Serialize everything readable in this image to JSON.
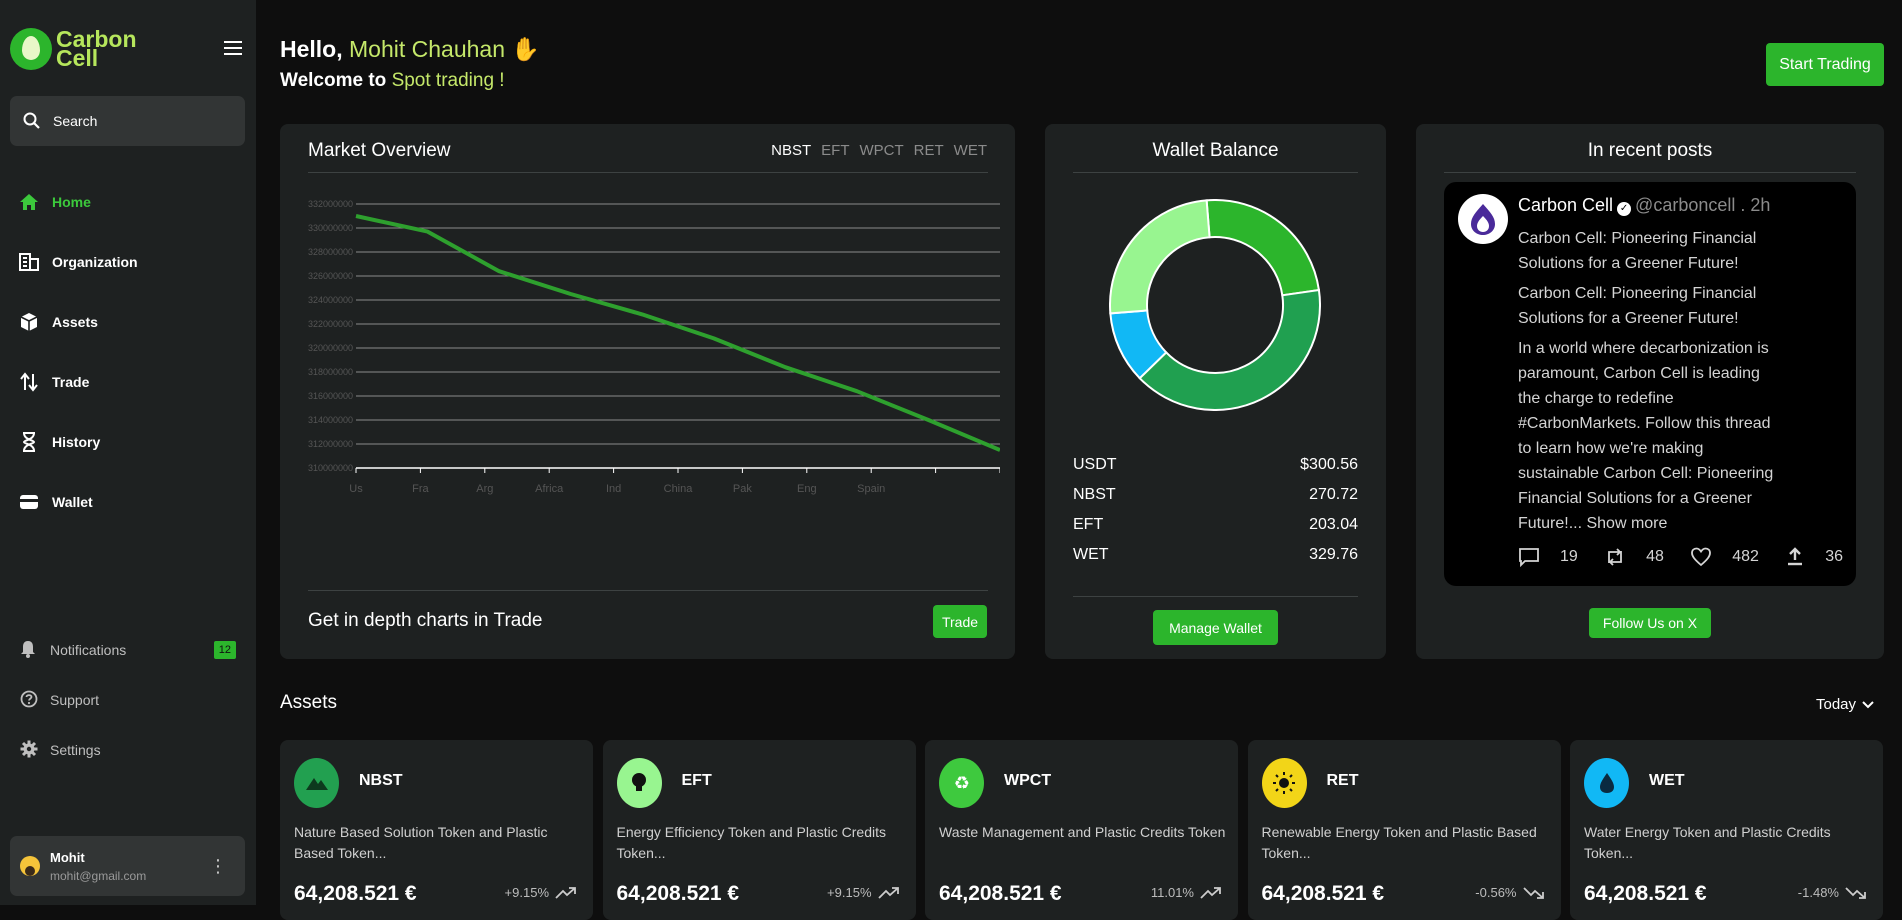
{
  "sidebar": {
    "logo_line1": "Carbon",
    "logo_line2": "Cell",
    "search_placeholder": "Search",
    "nav": [
      {
        "label": "Home",
        "icon": "home-icon"
      },
      {
        "label": "Organization",
        "icon": "organization-icon"
      },
      {
        "label": "Assets",
        "icon": "assets-icon"
      },
      {
        "label": "Trade",
        "icon": "trade-icon"
      },
      {
        "label": "History",
        "icon": "hourglass-icon"
      },
      {
        "label": "Wallet",
        "icon": "wallet-icon"
      }
    ],
    "bottom_nav": [
      {
        "label": "Notifications",
        "badge": "12"
      },
      {
        "label": "Support"
      },
      {
        "label": "Settings"
      }
    ],
    "user": {
      "name": "Mohit",
      "email": "mohit@gmail.com"
    }
  },
  "header": {
    "hello": "Hello,",
    "name": "Mohit Chauhan",
    "welcome": "Welcome to",
    "welcome_hl": "Spot trading !",
    "start_trading": "Start Trading"
  },
  "market": {
    "title": "Market Overview",
    "tabs": [
      "NBST",
      "EFT",
      "WPCT",
      "RET",
      "WET"
    ],
    "active_tab": "NBST",
    "footer_text": "Get in depth charts in Trade",
    "trade_button": "Trade"
  },
  "chart_data": {
    "type": "line",
    "categories": [
      "Us",
      "Fra",
      "Arg",
      "Africa",
      "Ind",
      "China",
      "Pak",
      "Eng",
      "Spain",
      ""
    ],
    "series": [
      {
        "values": [
          331000000,
          329700000,
          326400000,
          324500000,
          322800000,
          320800000,
          318400000,
          316400000,
          314000000,
          311500000
        ]
      }
    ],
    "yticks": [
      "332000000",
      "330000000",
      "328000000",
      "326000000",
      "324000000",
      "322000000",
      "320000000",
      "318000000",
      "316000000",
      "314000000",
      "312000000",
      "310000000"
    ],
    "ylim": [
      310000000,
      332000000
    ],
    "color": "#2ea02e",
    "grid": true
  },
  "wallet": {
    "title": "Wallet Balance",
    "rows": [
      {
        "label": "USDT",
        "value": "$300.56"
      },
      {
        "label": "NBST",
        "value": "270.72"
      },
      {
        "label": "EFT",
        "value": "203.04"
      },
      {
        "label": "WET",
        "value": "329.76"
      }
    ],
    "donut_slices": [
      {
        "value": 0.24,
        "color": "#2cb52c"
      },
      {
        "value": 0.4,
        "color": "#20a050"
      },
      {
        "value": 0.11,
        "color": "#11b8f5"
      },
      {
        "value": 0.25,
        "color": "#98f590"
      }
    ],
    "manage_button": "Manage Wallet"
  },
  "posts": {
    "title": "In recent posts",
    "author": "Carbon Cell",
    "handle": "@carboncell . 2h",
    "para1": "Carbon Cell: Pioneering Financial Solutions for a Greener Future!",
    "para2": "Carbon Cell: Pioneering Financial Solutions for a Greener Future!",
    "para3": "In a world where decarbonization is paramount, Carbon Cell is leading the charge to redefine #CarbonMarkets. Follow this thread to learn how we're making sustainable Carbon Cell: Pioneering Financial Solutions for a Greener Future!...",
    "show_more": "Show more",
    "replies": "19",
    "retweets": "48",
    "likes": "482",
    "shares": "36",
    "follow_button": "Follow Us on X"
  },
  "assets": {
    "title": "Assets",
    "period": "Today",
    "items": [
      {
        "name": "NBST",
        "desc": "Nature Based Solution Token and Plastic Based Token...",
        "price": "64,208.521 €",
        "change": "+9.15%",
        "color": "#22a050",
        "icon": "mountain-icon",
        "trend": "up"
      },
      {
        "name": "EFT",
        "desc": "Energy Efficiency Token and Plastic Credits Token...",
        "price": "64,208.521 €",
        "change": "+9.15%",
        "color": "#98f590",
        "icon": "bulb-icon",
        "trend": "up"
      },
      {
        "name": "WPCT",
        "desc": "Waste Management and Plastic Credits Token",
        "price": "64,208.521 €",
        "change": "11.01%",
        "color": "#3ec93e",
        "icon": "recycle-icon",
        "trend": "up"
      },
      {
        "name": "RET",
        "desc": "Renewable Energy Token and Plastic Based Token...",
        "price": "64,208.521 €",
        "change": "-0.56%",
        "color": "#f2d518",
        "icon": "sun-icon",
        "trend": "down"
      },
      {
        "name": "WET",
        "desc": "Water Energy Token and Plastic Credits Token...",
        "price": "64,208.521 €",
        "change": "-1.48%",
        "color": "#11b8f5",
        "icon": "droplet-icon",
        "trend": "down"
      }
    ]
  }
}
